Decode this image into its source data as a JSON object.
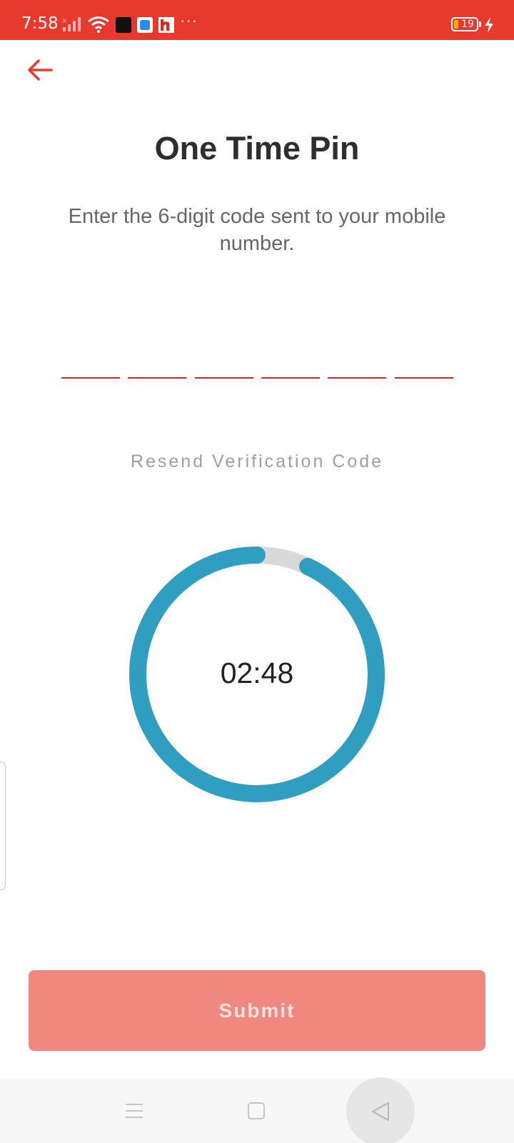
{
  "status_bar": {
    "time": "7:58",
    "more": "···",
    "battery_level": "19",
    "background_color": "#e8392e",
    "icons": [
      "signal-icon",
      "wifi-icon",
      "app-icon",
      "app-icon",
      "app-icon",
      "charging-icon"
    ]
  },
  "header": {
    "back_icon": "arrow-left-icon",
    "title": "One Time Pin",
    "subtitle": "Enter the 6-digit code sent to your mobile number."
  },
  "otp": {
    "digits": [
      "",
      "",
      "",
      "",
      "",
      ""
    ],
    "underline_color": "#e0241b"
  },
  "resend": {
    "label": "Resend Verification Code"
  },
  "timer": {
    "remaining": "02:48",
    "progress_fraction": 0.93,
    "progress_color": "#2f9ec0",
    "track_color": "#d9d9d9"
  },
  "submit": {
    "label": "Submit",
    "color": "#f08880"
  },
  "nav_bar": {
    "icons": [
      "menu-icon",
      "home-icon",
      "back-triangle-icon"
    ]
  }
}
